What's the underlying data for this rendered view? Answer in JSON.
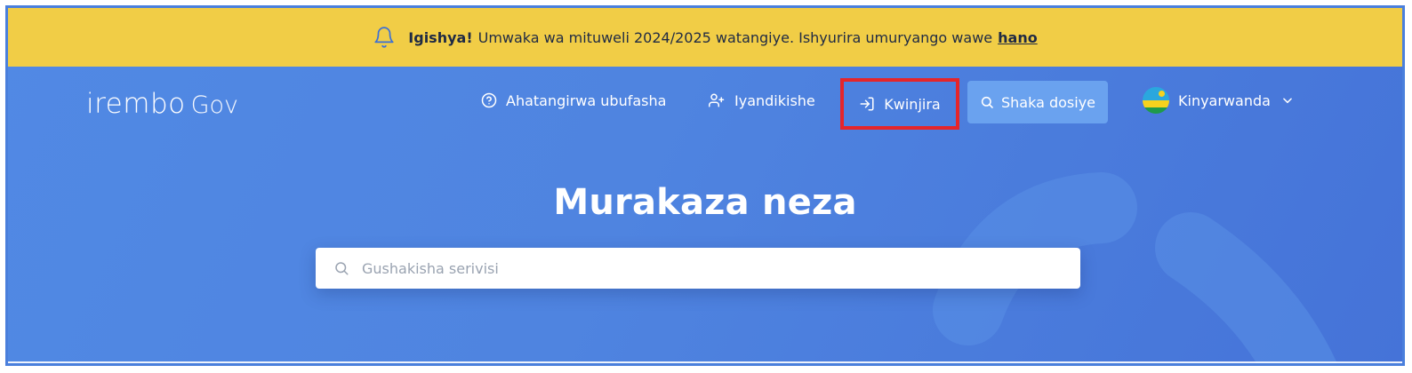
{
  "banner": {
    "icon": "bell-icon",
    "strong": "Igishya!",
    "message": "Umwaka wa mituweli 2024/2025 watangiye. Ishyurira umuryango wawe",
    "link": "hano",
    "background": "#f1cd46"
  },
  "header": {
    "logo": {
      "brand": "irembo",
      "suffix": "Gov"
    },
    "nav": {
      "help": {
        "label": "Ahatangirwa ubufasha",
        "icon": "help-circle-icon"
      },
      "register": {
        "label": "Iyandikishe",
        "icon": "user-plus-icon"
      },
      "login": {
        "label": "Kwinjira",
        "icon": "login-icon"
      },
      "search": {
        "label": "Shaka dosiye",
        "icon": "search-icon"
      },
      "language": {
        "label": "Kinyarwanda",
        "icon": "rwanda-flag-icon"
      }
    }
  },
  "hero": {
    "title": "Murakaza neza",
    "search_placeholder": "Gushakisha serivisi"
  },
  "colors": {
    "primary": "#4f84e0",
    "highlight": "#e5252a",
    "search_button": "#6aa2ef"
  }
}
